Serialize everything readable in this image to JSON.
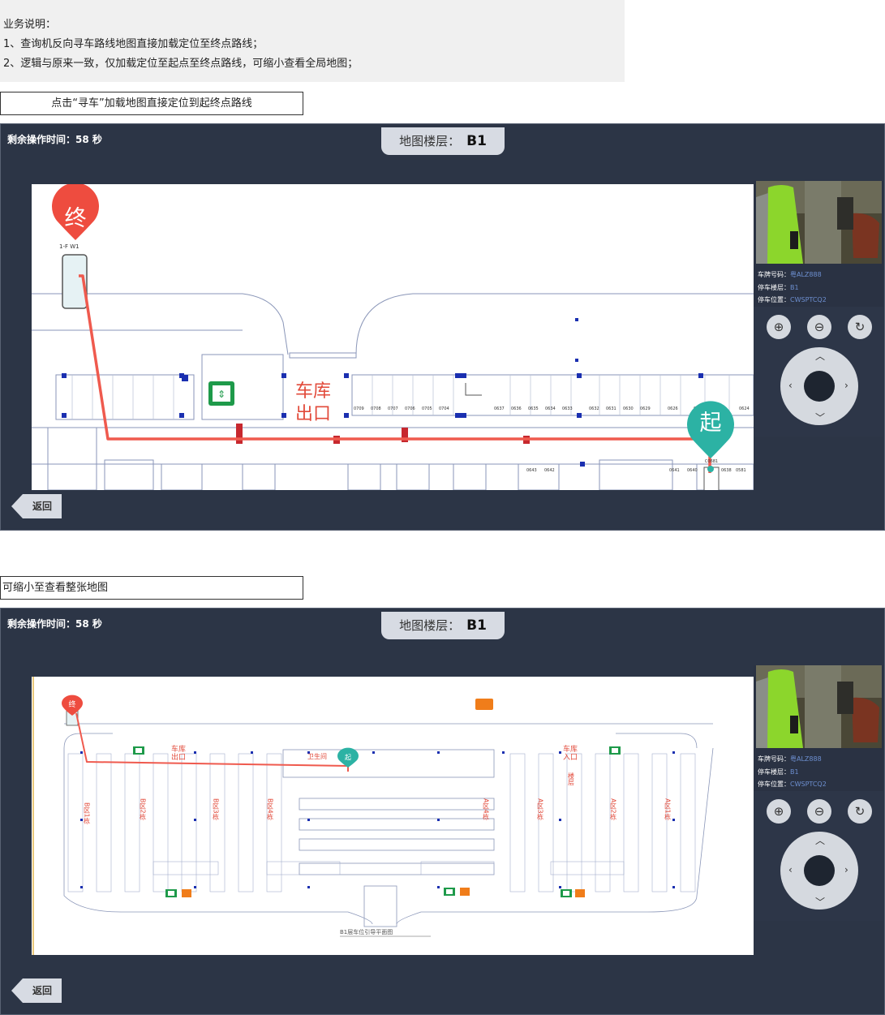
{
  "notes": {
    "title": "业务说明：",
    "line1": "1、查询机反向寻车路线地图直接加载定位至终点路线；",
    "line2": "2、逻辑与原来一致，仅加载定位至起点至终点路线，可缩小查看全局地图；"
  },
  "captions": {
    "first": "点击“寻车”加载地图直接定位到起终点路线",
    "second": "可缩小至查看整张地图"
  },
  "kiosk": {
    "timer": "剩余操作时间：58 秒",
    "floor_label": "地图楼层：",
    "floor_value": "B1",
    "back_label": "返回",
    "plate_label": "车牌号码：",
    "plate_value": "粤ALZ888",
    "level_label": "停车楼层：",
    "level_value": "B1",
    "spot_label": "停车位置：",
    "spot_value": "CWSPTCQ2"
  },
  "map": {
    "end_marker": "终",
    "start_marker": "起",
    "exit_label_1": "车库",
    "exit_label_2": "出口",
    "end_spot": "1-F   W1",
    "start_spot": "C0681",
    "entrance_label_1": "车库",
    "entrance_label_2": "入口",
    "toilet_label": "卫生间",
    "floor_plan_title": "B1层车位引导平面图",
    "spot_numbers": [
      "0709",
      "0708",
      "0707",
      "0706",
      "0705",
      "0704",
      "0637",
      "0636",
      "0635",
      "0634",
      "0633",
      "0632",
      "0631",
      "0630",
      "0629",
      "0626",
      "0625",
      "0624"
    ],
    "lower_numbers": [
      "0643",
      "0642",
      "0641",
      "0640",
      "0639",
      "0638",
      "0581"
    ],
    "zone_labels": [
      "B区1栋",
      "B区2栋",
      "B区3栋",
      "B区4栋",
      "A区4栋",
      "A区3栋",
      "A区2栋",
      "A区1栋"
    ],
    "stair_label": "楼层",
    "route_color": "#ef5a4e",
    "end_color": "#ee4c3f",
    "start_color": "#2cb2a4"
  },
  "controls": {
    "zoom_in": "zoom-in-icon",
    "zoom_out": "zoom-out-icon",
    "reset": "rotate-reset-icon",
    "up": "chevron-up-icon",
    "down": "chevron-down-icon",
    "left": "chevron-left-icon",
    "right": "chevron-right-icon"
  }
}
